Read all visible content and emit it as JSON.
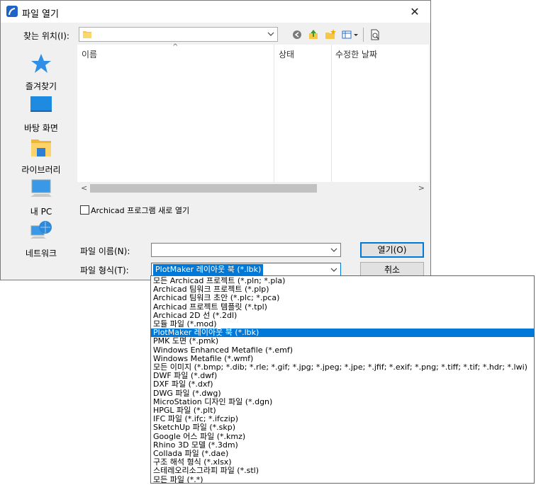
{
  "window": {
    "title": "파일 열기",
    "close": "✕"
  },
  "lookin": {
    "label": "찾는 위치(I):",
    "value": ""
  },
  "places": [
    {
      "label": "즐겨찾기",
      "icon": "star-icon"
    },
    {
      "label": "바탕 화면",
      "icon": "desktop-icon"
    },
    {
      "label": "라이브러리",
      "icon": "library-icon"
    },
    {
      "label": "내 PC",
      "icon": "computer-icon"
    },
    {
      "label": "네트워크",
      "icon": "network-icon"
    }
  ],
  "filelist": {
    "columns": [
      "이름",
      "상태",
      "수정한 날짜"
    ],
    "sort_indicator": "^"
  },
  "open_readonly": {
    "label": "Archicad 프로그램 새로 열기",
    "checked": false
  },
  "filename": {
    "label": "파일 이름(N):",
    "value": ""
  },
  "filetype": {
    "label": "파일 형식(T):",
    "value": "PlotMaker 레이아웃 북 (*.lbk)"
  },
  "buttons": {
    "open": "열기(O)",
    "cancel": "취소"
  },
  "filetype_options": [
    "모든 Archicad 프로젝트 (*.pln; *.pla)",
    "Archicad 팀워크 프로젝트 (*.plp)",
    "Archicad 팀워크 초안 (*.plc; *.pca)",
    "Archicad 프로젝트 템플릿 (*.tpl)",
    "Archicad 2D 선 (*.2dl)",
    "모듈 파일 (*.mod)",
    "PlotMaker 레이아웃 북 (*.lbk)",
    "PMK 도면 (*.pmk)",
    "Windows Enhanced Metafile (*.emf)",
    "Windows Metafile (*.wmf)",
    "모든 이미지 (*.bmp; *.dib; *.rle; *.gif; *.jpg; *.jpeg; *.jpe; *.jfif; *.exif; *.png; *.tiff; *.tif; *.hdr; *.lwi)",
    "DWF 파일 (*.dwf)",
    "DXF 파일 (*.dxf)",
    "DWG 파일 (*.dwg)",
    "MicroStation 디자인 파일 (*.dgn)",
    "HPGL 파일 (*.plt)",
    "IFC 파일 (*.ifc; *.ifczip)",
    "SketchUp 파일 (*.skp)",
    "Google 어스 파일 (*.kmz)",
    "Rhino 3D 모델 (*.3dm)",
    "Collada 파일 (*.dae)",
    "구조 해석 형식 (*.xlsx)",
    "스테레오리소그라피 파일 (*.stl)",
    "모든 파일 (*.*)"
  ],
  "selected_option_index": 6,
  "colors": {
    "accent": "#0078d7",
    "dialog_bg": "#f0f0f0"
  }
}
